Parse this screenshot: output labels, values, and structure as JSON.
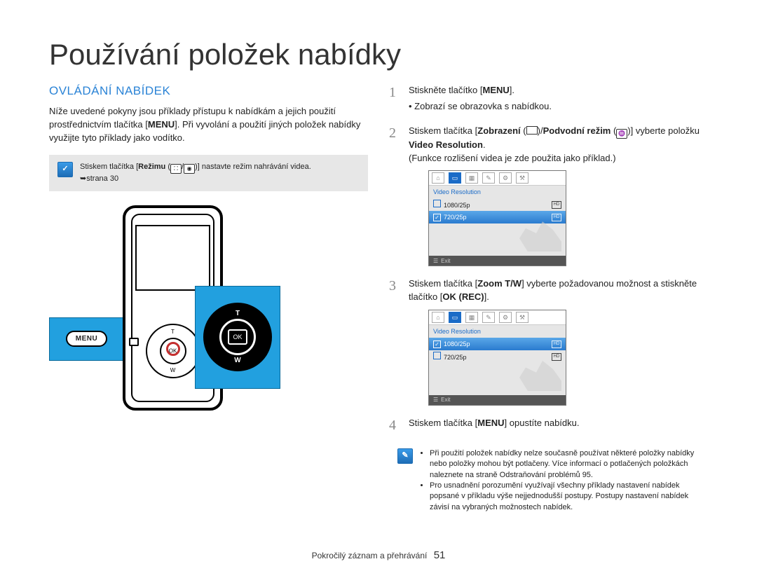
{
  "page_title": "Používání položek nabídky",
  "section_heading": "OVLÁDÁNÍ NABÍDEK",
  "intro_line1": "Níže uvedené pokyny jsou příklady přístupu k nabídkám a jejich použití prostřednictvím tlačítka [",
  "intro_menu_bold": "MENU",
  "intro_line2": "]. Při vyvolání a použití jiných položek nabídky využijte tyto příklady jako vodítko.",
  "tip1_a": "Stiskem tlačítka [",
  "tip1_bold": "Režimu",
  "tip1_b": " (",
  "tip1_c": ")] nastavte režim nahrávání videa.",
  "tip1_page": "strana 30",
  "steps": {
    "s1_a": "Stiskněte tlačítko [",
    "s1_bold": "MENU",
    "s1_b": "].",
    "s1_bullet": "Zobrazí se obrazovka s nabídkou.",
    "s2_a": "Stiskem tlačítka [",
    "s2_bold1": "Zobrazení",
    "s2_mid1": " (",
    "s2_mid2": ")",
    "s2_sep": "/",
    "s2_bold2": "Podvodní režim",
    "s2_mid3": " (",
    "s2_mid4": ")",
    "s2_b": "] vyberte položku ",
    "s2_bold3": "Video Resolution",
    "s2_c": ".",
    "s2_note": "(Funkce rozlišení videa je zde použita jako příklad.)",
    "s3_a": "Stiskem tlačítka [",
    "s3_bold1": "Zoom T/W",
    "s3_b": "] vyberte požadovanou možnost a stiskněte tlačítko [",
    "s3_bold2": "OK (REC)",
    "s3_c": "].",
    "s4_a": "Stiskem tlačítka [",
    "s4_bold": "MENU",
    "s4_b": "] opustíte nabídku."
  },
  "tip2_bullet1": "Při použití položek nabídky nelze současně používat některé položky nabídky nebo položky mohou být potlačeny. Více informací o potlačených položkách naleznete na straně Odstraňování problémů 95.",
  "tip2_bullet2": "Pro usnadnění porozumění využívají všechny příklady nastavení nabídek popsané v příkladu výše nejjednodušší postupy. Postupy nastavení nabídek závisí na vybraných možnostech nabídek.",
  "lcd": {
    "title": "Video Resolution",
    "opt1": "1080/25p",
    "opt2": "720/25p",
    "exit": "Exit"
  },
  "device": {
    "menu_label": "MENU",
    "t": "T",
    "w": "W",
    "ok": "OK"
  },
  "footer_label": "Pokročilý záznam a přehrávání",
  "footer_page": "51"
}
